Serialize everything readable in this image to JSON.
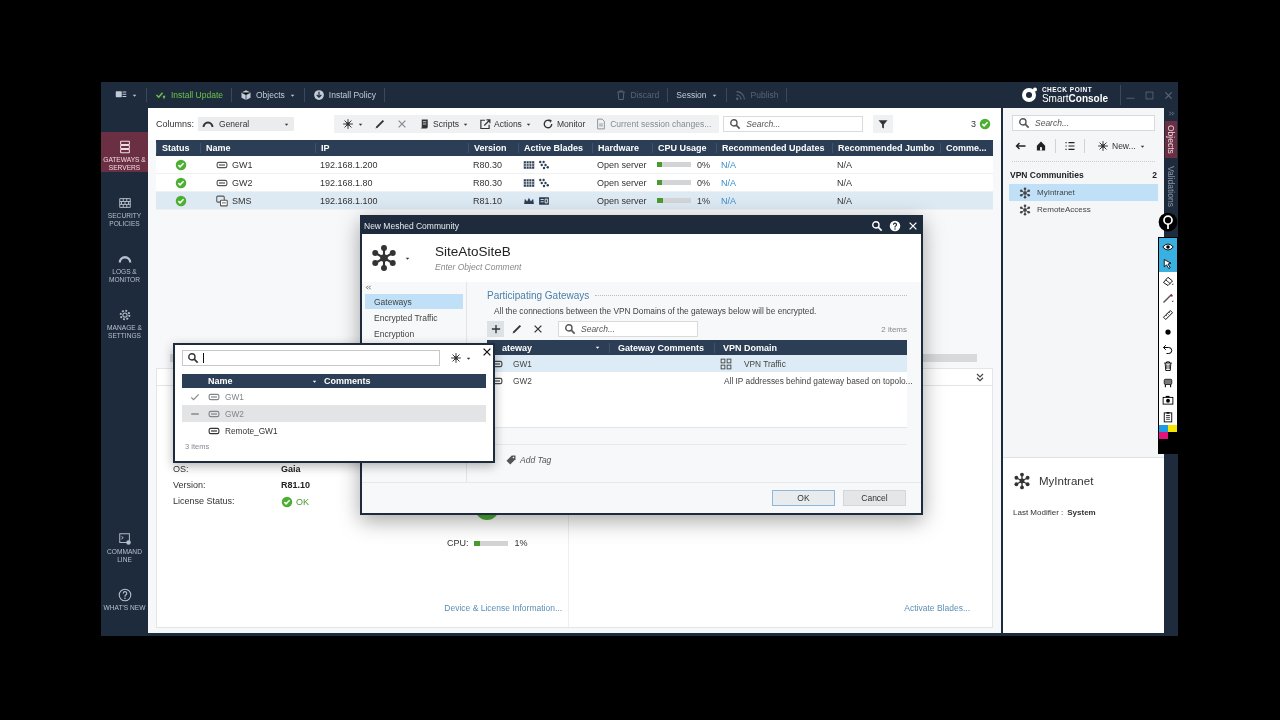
{
  "topbar": {
    "left_items": [
      {
        "label": "Install Update",
        "kind": "update",
        "disabled": false
      },
      {
        "label": "Objects",
        "kind": "objects",
        "disabled": false
      },
      {
        "label": "Install Policy",
        "kind": "policy",
        "disabled": false
      }
    ],
    "right_items": [
      {
        "label": "Discard",
        "kind": "trash",
        "disabled": true
      },
      {
        "label": "Session",
        "kind": "session",
        "disabled": false
      },
      {
        "label": "Publish",
        "kind": "publish",
        "disabled": true
      }
    ],
    "brand": {
      "company": "CHECK POINT",
      "product": "Smart**Console**"
    }
  },
  "nav": [
    {
      "label": "GATEWAYS & SERVERS",
      "kind": "servers",
      "selected": true
    },
    {
      "label": "SECURITY POLICIES",
      "kind": "policies",
      "selected": false
    },
    {
      "label": "LOGS & MONITOR",
      "kind": "logs",
      "selected": false
    },
    {
      "label": "MANAGE & SETTINGS",
      "kind": "settings",
      "selected": false
    }
  ],
  "nav_bottom": [
    {
      "label": "COMMAND LINE",
      "kind": "cli",
      "selected": false
    },
    {
      "label": "WHAT'S NEW",
      "kind": "help",
      "selected": false
    }
  ],
  "toolbar": {
    "columns_label": "Columns:",
    "columns_value": "General",
    "buttons": [
      {
        "kind": "new",
        "disabled": false
      },
      {
        "kind": "edit",
        "disabled": false
      },
      {
        "kind": "delete",
        "disabled": true
      },
      {
        "kind": "scripts",
        "label": "Scripts",
        "disabled": false
      },
      {
        "kind": "actions",
        "label": "Actions",
        "disabled": false
      },
      {
        "kind": "monitor",
        "label": "Monitor",
        "disabled": false
      }
    ],
    "session_changes": "Current session changes...",
    "search_placeholder": "Search...",
    "count": "3"
  },
  "table": {
    "columns": [
      "Status",
      "Name",
      "IP",
      "Version",
      "Active Blades",
      "Hardware",
      "CPU Usage",
      "Recommended Updates",
      "Recommended Jumbo",
      "Comme..."
    ],
    "rows": [
      {
        "online": true,
        "kind": "gateway",
        "name": "GW1",
        "ip": "192.168.1.200",
        "version": "R80.30",
        "blades": [
          {
            "kind": "grid"
          },
          {
            "kind": "dots"
          }
        ],
        "hardware": "Open server",
        "cpu": {
          "level": 0.15,
          "reading": "0%"
        },
        "updates": "N/A",
        "jumbo": "N/A",
        "selected": false
      },
      {
        "online": true,
        "kind": "gateway",
        "name": "GW2",
        "ip": "192.168.1.80",
        "version": "R80.30",
        "blades": [
          {
            "kind": "grid"
          },
          {
            "kind": "dots"
          }
        ],
        "hardware": "Open server",
        "cpu": {
          "level": 0.15,
          "reading": "0%"
        },
        "updates": "N/A",
        "jumbo": "N/A",
        "selected": false
      },
      {
        "online": true,
        "kind": "server",
        "name": "SMS",
        "ip": "192.168.1.100",
        "version": "R81.10",
        "blades": [
          {
            "kind": "crown"
          },
          {
            "kind": "card"
          }
        ],
        "hardware": "Open server",
        "cpu": {
          "level": 0.17,
          "reading": "1%"
        },
        "updates": "N/A",
        "jumbo": "N/A",
        "selected": true
      }
    ]
  },
  "details": {
    "rows": [
      {
        "label": "OS:",
        "value": "Gaia",
        "kind": "text"
      },
      {
        "label": "Version:",
        "value": "R81.10",
        "kind": "text"
      },
      {
        "label": "License Status:",
        "value": "OK",
        "kind": "status"
      }
    ],
    "cpu": {
      "label": "CPU:",
      "level": 0.15,
      "reading": "1%"
    },
    "links": [
      "Device & License Information...",
      "Activate Blades..."
    ]
  },
  "picker": {
    "columns": [
      "Name",
      "Comments"
    ],
    "rows": [
      {
        "name": "GW1",
        "checked": true,
        "partial": false,
        "disabled": true,
        "selected": false
      },
      {
        "name": "GW2",
        "checked": false,
        "partial": true,
        "disabled": true,
        "selected": true
      },
      {
        "name": "Remote_GW1",
        "checked": false,
        "partial": false,
        "disabled": false,
        "selected": false
      }
    ],
    "footer": "3 items"
  },
  "dialog": {
    "title": "New Meshed Community",
    "name": "SiteAtoSiteB",
    "comment_placeholder": "Enter Object Comment",
    "nav": [
      {
        "label": "Gateways",
        "selected": true
      },
      {
        "label": "Encrypted Traffic",
        "selected": false
      },
      {
        "label": "Encryption",
        "selected": false
      }
    ],
    "section_title": "Participating Gateways",
    "description": "All the connections between the VPN Domains of the gateways below will be encrypted.",
    "search_placeholder": "Search...",
    "item_count": "2 items",
    "columns": [
      "ateway",
      "Gateway Comments",
      "VPN Domain"
    ],
    "rows": [
      {
        "gateway": "GW1",
        "domain": {
          "kind": "group",
          "label": "VPN Traffic"
        },
        "selected": true
      },
      {
        "gateway": "GW2",
        "domain": {
          "kind": "text",
          "label": "All IP addresses behind gateway based on topolo..."
        },
        "selected": false
      }
    ],
    "add_tag": "Add Tag",
    "buttons": [
      {
        "label": "OK",
        "default": true
      },
      {
        "label": "Cancel",
        "default": false
      }
    ]
  },
  "objects_panel": {
    "search_placeholder": "Search...",
    "new_label": "New...",
    "section": "VPN Communities",
    "count": "2",
    "items": [
      {
        "label": "MyIntranet",
        "selected": true
      },
      {
        "label": "RemoteAccess",
        "selected": false
      }
    ],
    "summary": {
      "name": "MyIntranet",
      "modifier_label": "Last Modifier :",
      "modifier": "System"
    }
  },
  "side_tabs": [
    {
      "label": "Objects",
      "selected": true
    },
    {
      "label": "Validations",
      "selected": false
    }
  ],
  "annotation_tools": [
    {
      "kind": "eye",
      "selected": true
    },
    {
      "kind": "pointer",
      "selected": true
    },
    {
      "kind": "eraser",
      "selected": false
    },
    {
      "kind": "pen",
      "selected": false
    },
    {
      "kind": "ruler",
      "selected": false
    },
    {
      "kind": "dot",
      "selected": false
    },
    {
      "kind": "undo",
      "selected": false
    },
    {
      "kind": "trash",
      "selected": false
    },
    {
      "kind": "stamp",
      "selected": false
    },
    {
      "kind": "camera",
      "selected": false
    },
    {
      "kind": "clipboard",
      "selected": false
    }
  ]
}
